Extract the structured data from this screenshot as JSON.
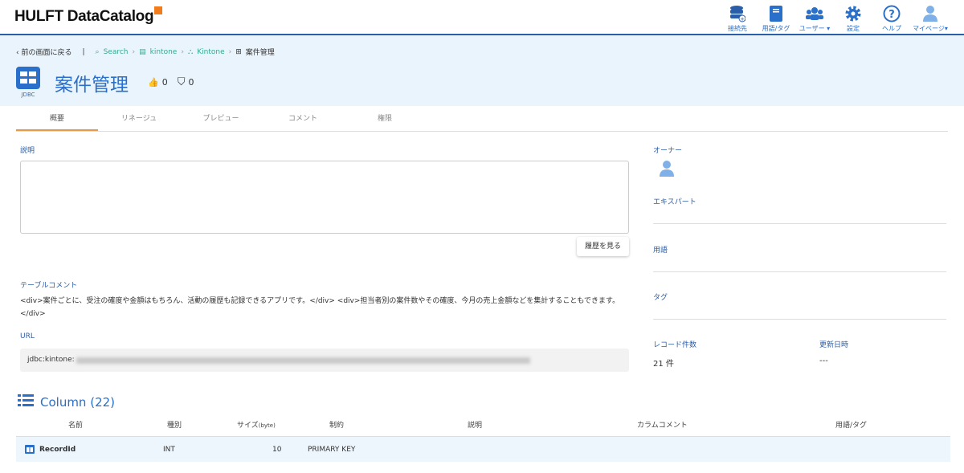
{
  "app": {
    "logo": "HULFT DataCatalog"
  },
  "nav": [
    {
      "label": "接続先",
      "icon": "database-plus-icon"
    },
    {
      "label": "用語/タグ",
      "icon": "book-icon"
    },
    {
      "label": "ユーザー ▾",
      "icon": "users-icon"
    },
    {
      "label": "設定",
      "icon": "gear-icon"
    },
    {
      "label": "ヘルプ",
      "icon": "question-circle-icon"
    },
    {
      "label": "マイページ▾",
      "icon": "user-icon"
    }
  ],
  "breadcrumb": {
    "back": "前の画面に戻る",
    "items": [
      "Search",
      "kintone",
      "Kintone",
      "案件管理"
    ]
  },
  "header": {
    "title": "案件管理",
    "type": "JDBC",
    "likes": "0",
    "bookmarks": "0"
  },
  "tabs": [
    "概要",
    "リネージュ",
    "プレビュー",
    "コメント",
    "権限"
  ],
  "main": {
    "description_label": "説明",
    "history_button": "履歴を見る",
    "table_comment_label": "テーブルコメント",
    "table_comment": "<div>案件ごとに、受注の確度や金額はもちろん、活動の履歴も記録できるアプリです。</div> <div>担当者別の案件数やその確度、今月の売上金額などを集計することもできます。</div>",
    "url_label": "URL",
    "url_prefix": "jdbc:kintone:"
  },
  "side": {
    "owner": "オーナー",
    "expert": "エキスパート",
    "term": "用語",
    "tag": "タグ",
    "record_label": "レコード件数",
    "record_value": "21 件",
    "updated_label": "更新日時",
    "updated_value": "---"
  },
  "columns": {
    "title": "Column (22)",
    "headers": [
      "名前",
      "種別",
      "サイズ",
      "(byte)",
      "制約",
      "説明",
      "カラムコメント",
      "用語/タグ"
    ],
    "rows": [
      {
        "name": "RecordId",
        "type": "INT",
        "size": "10",
        "constraint": "PRIMARY KEY"
      }
    ]
  }
}
